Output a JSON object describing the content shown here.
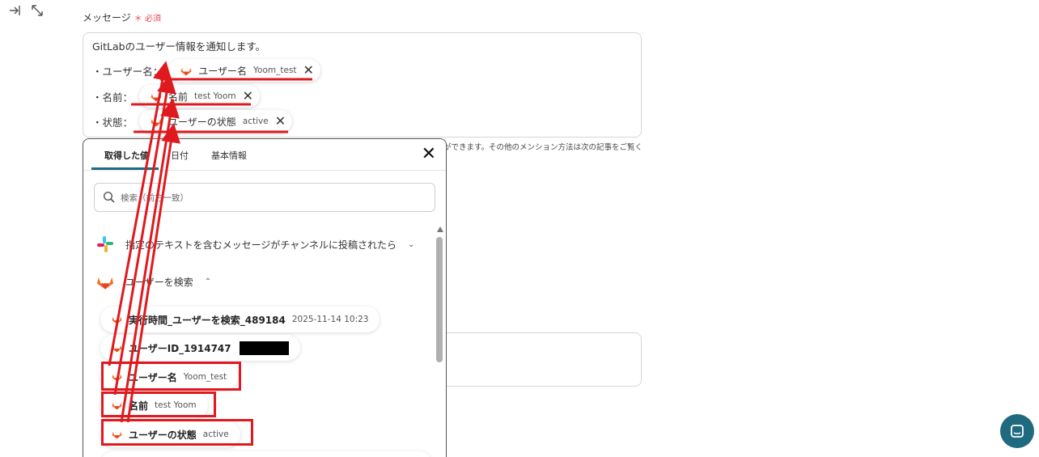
{
  "field": {
    "label": "メッセージ",
    "required": "＊ 必須"
  },
  "message": {
    "line0": "GitLabのユーザー情報を通知します。",
    "rows": [
      {
        "prefix": "・ユーザー名：",
        "chip_label": "ユーザー名",
        "chip_value": "Yoom_test"
      },
      {
        "prefix": "・名前：",
        "chip_label": "名前",
        "chip_value": "test Yoom"
      },
      {
        "prefix": "・状態：",
        "chip_label": "ユーザーの状態",
        "chip_value": "active"
      }
    ]
  },
  "hint": "ができます。その他のメンション方法は次の記事をご覧く",
  "panel": {
    "tabs": [
      "取得した値",
      "日付",
      "基本情報"
    ],
    "search_placeholder": "検索（前方一致）",
    "groups": [
      {
        "title": "指定のテキストを含むメッセージがチャンネルに投稿されたら",
        "chevron": "⌄",
        "icon": "slack-icon"
      },
      {
        "title": "ユーザーを検索",
        "chevron": "⌃",
        "icon": "gitlab-icon"
      }
    ],
    "items": [
      {
        "label": "実行時間_ユーザーを検索_489184",
        "value": "2025-11-14 10:23"
      },
      {
        "label": "ユーザーID_1914747",
        "value": ""
      },
      {
        "label": "ユーザー名",
        "value": "Yoom_test"
      },
      {
        "label": "名前",
        "value": "test Yoom"
      },
      {
        "label": "ユーザーの状態",
        "value": "active"
      }
    ]
  },
  "colors": {
    "accent": "#1f6a7f",
    "annotation": "#e0191e",
    "required": "#e5484d"
  }
}
